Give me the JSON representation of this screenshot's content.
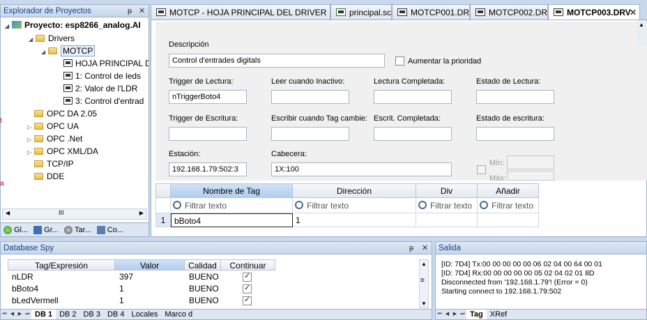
{
  "explorer": {
    "title": "Explorador de Proyectos",
    "pin": "ᵽ",
    "close": "✕",
    "tree": [
      {
        "label": "Proyecto: esp8266_analog.AI",
        "icon": "project-icon",
        "bold": true
      },
      {
        "label": "Drivers",
        "icon": "folder-icon"
      },
      {
        "label": "MOTCP",
        "icon": "folder-icon",
        "selected": true
      },
      {
        "label": "HOJA PRINCIPAL D",
        "icon": "page-icon"
      },
      {
        "label": "1: Control de leds",
        "icon": "page-icon"
      },
      {
        "label": "2: Valor de l'LDR",
        "icon": "page-icon"
      },
      {
        "label": "3: Control d'entrad",
        "icon": "page-icon"
      },
      {
        "label": "OPC DA 2.05",
        "icon": "folder-icon"
      },
      {
        "label": "OPC UA",
        "icon": "folder-icon"
      },
      {
        "label": "OPC .Net",
        "icon": "folder-icon"
      },
      {
        "label": "OPC XML/DA",
        "icon": "folder-icon"
      },
      {
        "label": "TCP/IP",
        "icon": "folder-icon"
      },
      {
        "label": "DDE",
        "icon": "folder-icon"
      }
    ],
    "scroll_grip": "III",
    "bottom_tabs": [
      "Gl...",
      "Gr...",
      "Tar...",
      "Co..."
    ]
  },
  "tabs": [
    {
      "label": "MOTCP - HOJA PRINCIPAL DEL DRIVER"
    },
    {
      "label": "principal.scc"
    },
    {
      "label": "MOTCP001.DRV"
    },
    {
      "label": "MOTCP002.DRV"
    },
    {
      "label": "MOTCP003.DRV",
      "active": true
    }
  ],
  "tab_close": "✕",
  "form": {
    "descripcion_label": "Descripción",
    "descripcion_value": "Control d'entrades digitals",
    "aumentar_label": "Aumentar la prioridad",
    "trigger_lectura_label": "Trigger de Lectura:",
    "trigger_lectura_value": "nTriggerBoto4",
    "leer_inactivo_label": "Leer cuando Inactivo:",
    "lectura_completada_label": "Lectura Completada:",
    "estado_lectura_label": "Estado de Lectura:",
    "trigger_escritura_label": "Trigger de Escritura:",
    "escribir_cambie_label": "Escribir cuando Tag cambie:",
    "escrit_completada_label": "Escrit. Completada:",
    "estado_escritura_label": "Estado de escritura:",
    "estacion_label": "Estación:",
    "estacion_value": "192.168.1.79:502:3",
    "cabecera_label": "Cabecera:",
    "cabecera_value": "1X:100",
    "min_label": "Mín:",
    "max_label": "Máx:"
  },
  "grid": {
    "columns": [
      "Nombre de Tag",
      "Dirección",
      "Div",
      "Añadir"
    ],
    "filter_placeholder": "Filtrar texto",
    "rows": [
      {
        "num": "1",
        "tag": "bBoto4",
        "dir": "1"
      }
    ]
  },
  "spy": {
    "title": "Database Spy",
    "columns": [
      "Tag/Expresión",
      "Valor",
      "Calidad",
      "Continuar"
    ],
    "rows": [
      {
        "tag": "nLDR",
        "valor": "397",
        "calidad": "BUENO",
        "continuar": true
      },
      {
        "tag": "bBoto4",
        "valor": "1",
        "calidad": "BUENO",
        "continuar": true
      },
      {
        "tag": "bLedVermell",
        "valor": "1",
        "calidad": "BUENO",
        "continuar": true
      }
    ],
    "tabs": [
      "DB 1",
      "DB 2",
      "DB 3",
      "DB 4",
      "Locales",
      "Marco d"
    ]
  },
  "salida": {
    "title": "Salida",
    "lines": [
      "[ID: 7D4] Tx:00 00 00 00 00 06 02 04 00 64 00 01",
      "[ID: 7D4] Rx:00 00 00 00 00 05 02 04 02 01 8D",
      "Disconnected from '192.168.1.79'! (Error = 0)",
      "Starting connect to 192.168.1.79:502"
    ],
    "tabs": [
      "Tag",
      "XRef"
    ]
  },
  "colors": {
    "accent": "#15428b",
    "frame": "#c9d8ec",
    "header_selected": "#b2cdee"
  }
}
